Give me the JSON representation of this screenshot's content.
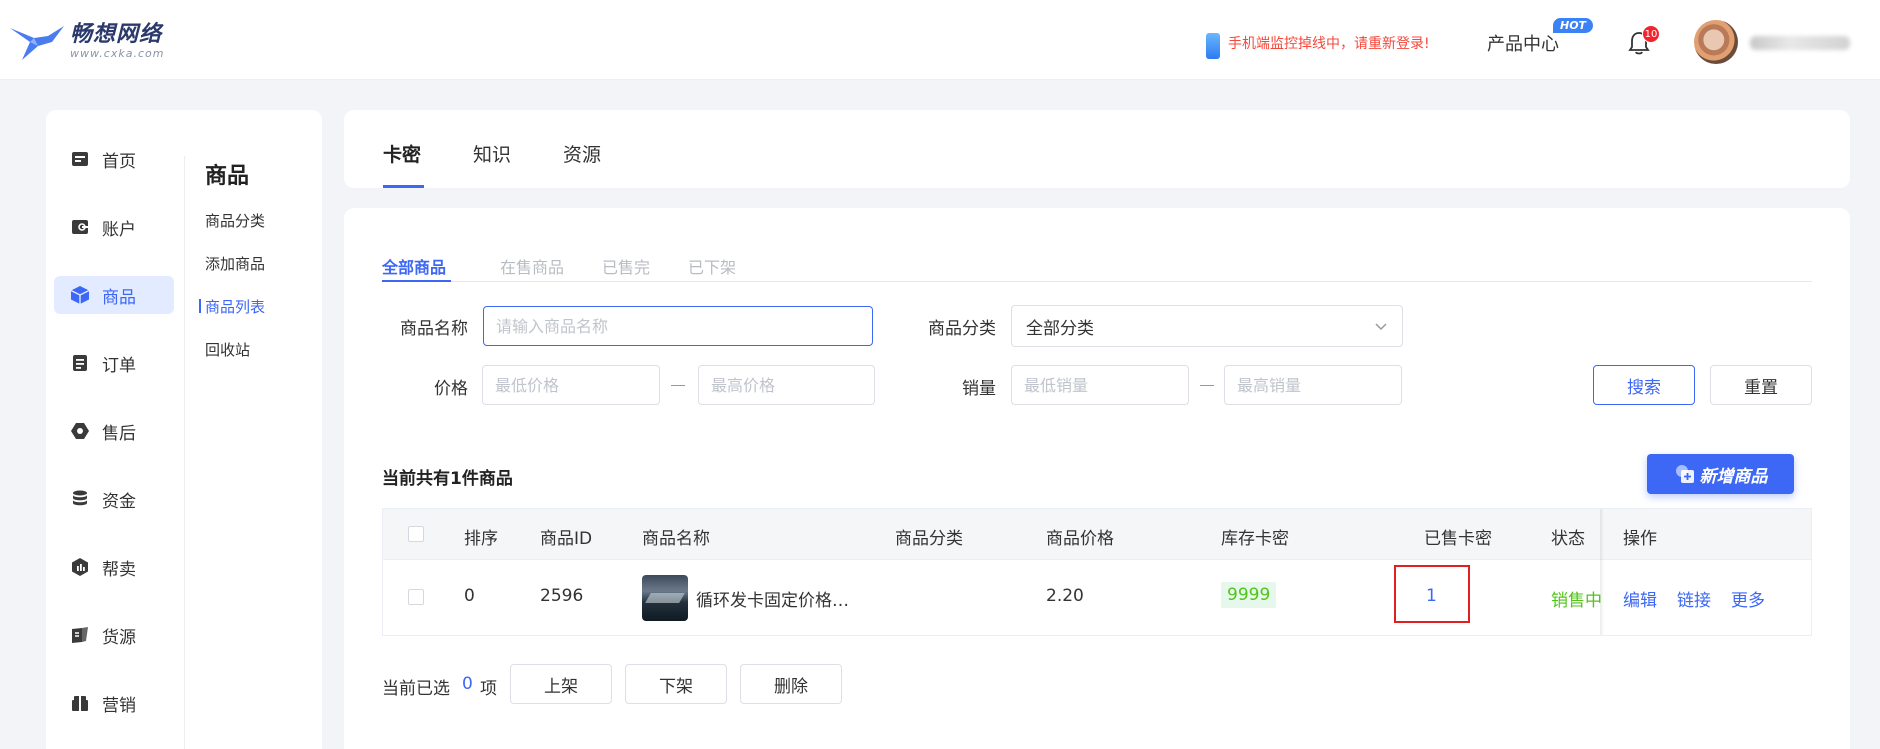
{
  "header": {
    "brand_name": "畅想网络",
    "brand_url": "www.cxka.com",
    "warning": "手机端监控掉线中，请重新登录!",
    "product_center": "产品中心",
    "hot_badge": "HOT",
    "notification_count": "10"
  },
  "sidebar": {
    "items": [
      {
        "label": "首页",
        "icon": "home-icon"
      },
      {
        "label": "账户",
        "icon": "wallet-icon"
      },
      {
        "label": "商品",
        "icon": "cube-icon"
      },
      {
        "label": "订单",
        "icon": "order-icon"
      },
      {
        "label": "售后",
        "icon": "aftersale-icon"
      },
      {
        "label": "资金",
        "icon": "coins-icon"
      },
      {
        "label": "帮卖",
        "icon": "shop-icon"
      },
      {
        "label": "货源",
        "icon": "source-icon"
      },
      {
        "label": "营销",
        "icon": "marketing-icon"
      }
    ],
    "active_index": 2
  },
  "subnav": {
    "title": "商品",
    "items": [
      "商品分类",
      "添加商品",
      "商品列表",
      "回收站"
    ],
    "active_index": 2
  },
  "top_tabs": [
    "卡密",
    "知识",
    "资源"
  ],
  "status_tabs": [
    "全部商品",
    "在售商品",
    "已售完",
    "已下架"
  ],
  "filters": {
    "name_label": "商品名称",
    "name_placeholder": "请输入商品名称",
    "category_label": "商品分类",
    "category_value": "全部分类",
    "price_label": "价格",
    "price_min_placeholder": "最低价格",
    "price_max_placeholder": "最高价格",
    "sales_label": "销量",
    "sales_min_placeholder": "最低销量",
    "sales_max_placeholder": "最高销量",
    "search_button": "搜索",
    "reset_button": "重置"
  },
  "total_text": "当前共有1件商品",
  "new_button": "新增商品",
  "table": {
    "headers": [
      "排序",
      "商品ID",
      "商品名称",
      "商品分类",
      "商品价格",
      "库存卡密",
      "已售卡密",
      "状态",
      "操作"
    ],
    "rows": [
      {
        "sort": "0",
        "id": "2596",
        "name": "循环发卡固定价格…",
        "category": "",
        "price": "2.20",
        "stock": "9999",
        "sold": "1",
        "status": "销售中",
        "ops": [
          "编辑",
          "链接",
          "更多"
        ]
      }
    ]
  },
  "bottom": {
    "selected_prefix": "当前已选",
    "selected_count": "0",
    "selected_suffix": "项",
    "actions": [
      "上架",
      "下架",
      "删除"
    ]
  },
  "colors": {
    "primary": "#3d67f5",
    "success": "#52c41a",
    "danger": "#e02020",
    "warning_text": "#f5483b"
  }
}
